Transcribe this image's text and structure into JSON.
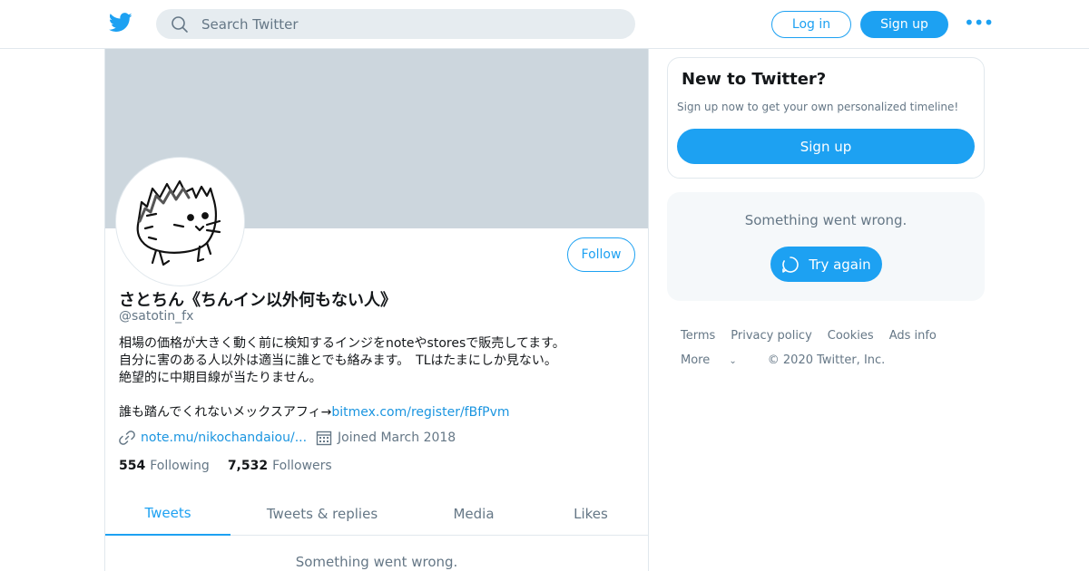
{
  "topbar": {
    "search_placeholder": "Search Twitter",
    "login_label": "Log in",
    "signup_label": "Sign up",
    "more_label": "•••"
  },
  "profile": {
    "name": "さとちん《ちんイン以外何もない人》",
    "handle": "@satotin_fx",
    "follow_label": "Follow",
    "bio_lines": [
      "相場の価格が大きく動く前に検知するインジをnoteやstoresで販売してます。",
      "自分に害のある人以外は適当に誰とでも絡みます。　TLはたまにしか見ない。",
      "絶望的に中期目線が当たりません。"
    ],
    "bio_link_prefix": "誰も踏んでくれないメックスアフィ→",
    "bio_link": "bitmex.com/register/fBfPvm",
    "website": "note.mu/nikochandaiou/...",
    "joined": "Joined March 2018",
    "following_count": "554",
    "following_label": "Following",
    "followers_count": "7,532",
    "followers_label": "Followers"
  },
  "tabs": [
    "Tweets",
    "Tweets & replies",
    "Media",
    "Likes"
  ],
  "main_error": "Something went wrong.",
  "sidebar": {
    "new_title": "New to Twitter?",
    "new_text": "Sign up now to get your own personalized timeline!",
    "signup_label": "Sign up",
    "error_text": "Something went wrong.",
    "try_again_label": "Try again"
  },
  "footer": {
    "links": [
      "Terms",
      "Privacy policy",
      "Cookies",
      "Ads info"
    ],
    "more_label": "More",
    "copyright": "© 2020 Twitter, Inc."
  },
  "colors": {
    "accent": "#1da1f2",
    "banner": "#ccd6dd"
  }
}
